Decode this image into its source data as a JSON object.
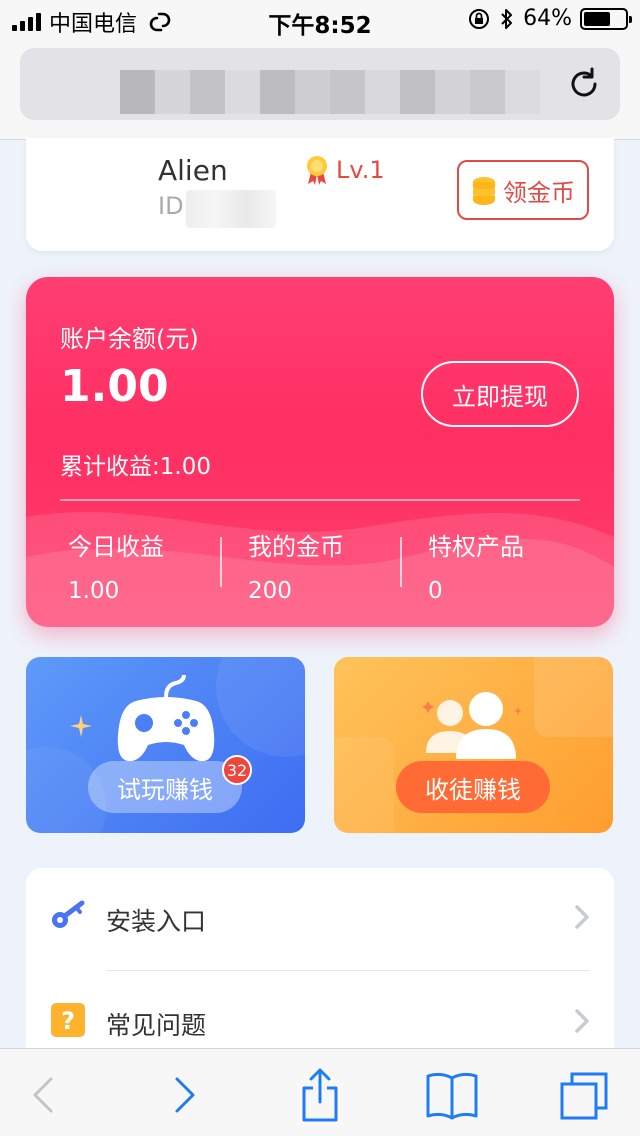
{
  "status_bar": {
    "carrier": "中国电信",
    "time": "下午8:52",
    "battery_percent": "64%",
    "battery_level": 0.64
  },
  "profile": {
    "name": "Alien",
    "id_label": "ID:",
    "level": "Lv.1",
    "coin_button": "领金币"
  },
  "balance": {
    "label": "账户余额(元)",
    "value": "1.00",
    "withdraw_button": "立即提现",
    "cumulative": "累计收益:1.00",
    "stats": [
      {
        "label": "今日收益",
        "value": "1.00"
      },
      {
        "label": "我的金币",
        "value": "200"
      },
      {
        "label": "特权产品",
        "value": "0"
      }
    ]
  },
  "actions": {
    "play": {
      "label": "试玩赚钱",
      "badge": "32"
    },
    "recruit": {
      "label": "收徒赚钱"
    }
  },
  "menu": {
    "items": [
      {
        "label": "安装入口"
      },
      {
        "label": "常见问题"
      }
    ]
  },
  "colors": {
    "accent_pink": "#ff3366",
    "play_blue": "#4a7ff5",
    "recruit_orange": "#ffa53a",
    "coin_red": "#e24a45"
  }
}
